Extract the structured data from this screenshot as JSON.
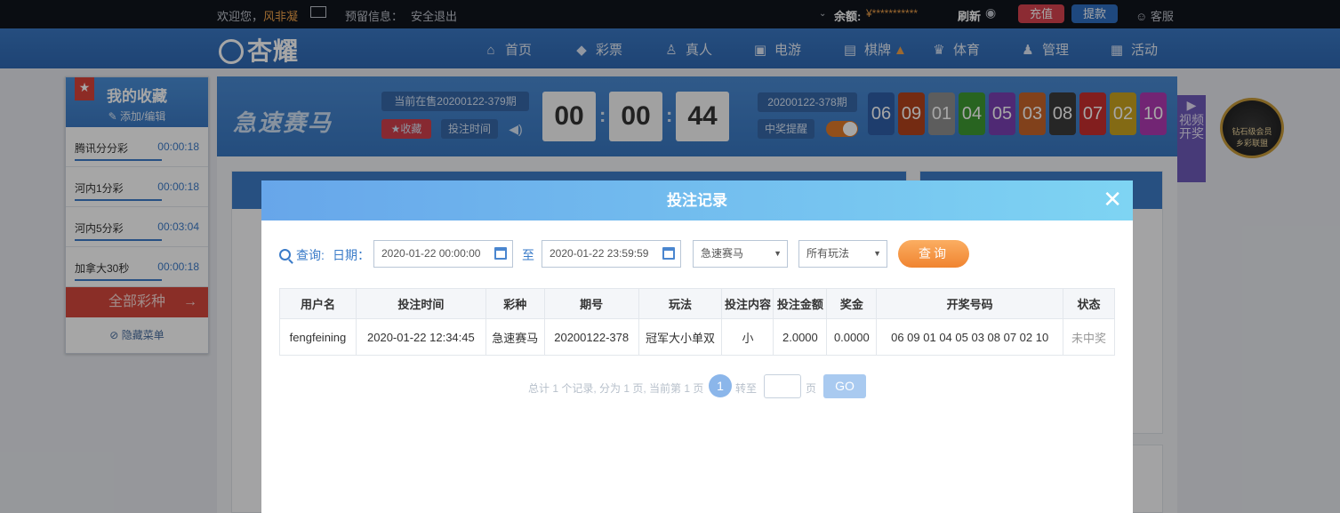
{
  "topbar": {
    "welcome": "欢迎您，",
    "username": "风非凝",
    "reserved_info": "预留信息：",
    "logout": "安全退出",
    "balance_label": "余额:",
    "balance_value": "¥***********",
    "refresh": "刷新",
    "deposit": "充值",
    "withdraw": "提款",
    "service": "客服"
  },
  "nav": {
    "logo": "杏耀",
    "items": [
      {
        "label": "首页",
        "icon": "home-icon"
      },
      {
        "label": "彩票",
        "icon": "ticket-icon"
      },
      {
        "label": "真人",
        "icon": "person-icon"
      },
      {
        "label": "电游",
        "icon": "arcade-icon"
      },
      {
        "label": "棋牌",
        "icon": "cards-icon"
      },
      {
        "label": "体育",
        "icon": "trophy-icon"
      },
      {
        "label": "管理",
        "icon": "users-icon"
      },
      {
        "label": "活动",
        "icon": "gift-icon"
      }
    ]
  },
  "favorites": {
    "title": "我的收藏",
    "edit": "添加/编辑",
    "items": [
      {
        "name": "腾讯分分彩",
        "time": "00:00:18"
      },
      {
        "name": "河内1分彩",
        "time": "00:00:18"
      },
      {
        "name": "河内5分彩",
        "time": "00:03:04"
      },
      {
        "name": "加拿大30秒",
        "time": "00:00:18"
      }
    ],
    "all_games": "全部彩种",
    "hide_menu": "隐藏菜单"
  },
  "game": {
    "name": "急速赛马",
    "current_issue": "当前在售20200122-379期",
    "favorite": "收藏",
    "bet_time": "投注时间",
    "countdown": [
      "00",
      "00",
      "44"
    ],
    "last_issue": "20200122-378期",
    "win_remind": "中奖提醒",
    "balls": [
      {
        "num": "06",
        "color": "#2f5fa8"
      },
      {
        "num": "09",
        "color": "#b2431d"
      },
      {
        "num": "01",
        "color": "#8f8f8f"
      },
      {
        "num": "04",
        "color": "#3e9a32"
      },
      {
        "num": "05",
        "color": "#7a3fb3"
      },
      {
        "num": "03",
        "color": "#c7652a"
      },
      {
        "num": "08",
        "color": "#3b3b3b"
      },
      {
        "num": "07",
        "color": "#c82e2e"
      },
      {
        "num": "02",
        "color": "#c9a320"
      },
      {
        "num": "10",
        "color": "#b03ab3"
      }
    ],
    "video_tab": "视频开奖",
    "badge_line1": "钻石级会员",
    "badge_line2": "乡彩联盟"
  },
  "modal": {
    "title": "投注记录",
    "query_label": "查询:",
    "date_label": "日期：",
    "date_from": "2020-01-22 00:00:00",
    "to": "至",
    "date_to": "2020-01-22 23:59:59",
    "lottery_select": "急速赛马",
    "play_select": "所有玩法",
    "query_button": "查询",
    "columns": [
      "用户名",
      "投注时间",
      "彩种",
      "期号",
      "玩法",
      "投注内容",
      "投注金额",
      "奖金",
      "开奖号码",
      "状态"
    ],
    "rows": [
      {
        "user": "fengfeining",
        "time": "2020-01-22 12:34:45",
        "lottery": "急速赛马",
        "issue": "20200122-378",
        "play": "冠军大小单双",
        "content": "小",
        "amount": "2.0000",
        "bonus": "0.0000",
        "numbers": "06 09 01 04 05 03 08 07 02 10",
        "status": "未中奖"
      }
    ],
    "pager": {
      "summary": "总计 1 个记录, 分为 1 页, 当前第 1 页",
      "current": "1",
      "jump_to": "转至",
      "page_unit": "页",
      "go": "GO"
    }
  }
}
